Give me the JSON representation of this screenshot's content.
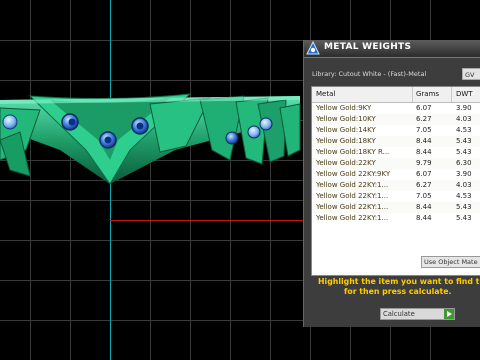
{
  "panel": {
    "title": "METAL WEIGHTS",
    "library_label": "Library: Cutout White - (Fast)-Metal",
    "library_button": "GV",
    "columns": [
      "Metal",
      "Grams",
      "DWT"
    ],
    "rows": [
      {
        "metal": "Yellow Gold:9KY",
        "grams": "6.07",
        "dwt": "3.90"
      },
      {
        "metal": "Yellow Gold:10KY",
        "grams": "6.27",
        "dwt": "4.03"
      },
      {
        "metal": "Yellow Gold:14KY",
        "grams": "7.05",
        "dwt": "4.53"
      },
      {
        "metal": "Yellow Gold:18KY",
        "grams": "8.44",
        "dwt": "5.43"
      },
      {
        "metal": "Yellow Gold:18KY R...",
        "grams": "8.44",
        "dwt": "5.43"
      },
      {
        "metal": "Yellow Gold:22KY",
        "grams": "9.79",
        "dwt": "6.30"
      },
      {
        "metal": "Yellow Gold 22KY:9KY",
        "grams": "6.07",
        "dwt": "3.90"
      },
      {
        "metal": "Yellow Gold 22KY:1...",
        "grams": "6.27",
        "dwt": "4.03"
      },
      {
        "metal": "Yellow Gold 22KY:1...",
        "grams": "7.05",
        "dwt": "4.53"
      },
      {
        "metal": "Yellow Gold 22KY:1...",
        "grams": "8.44",
        "dwt": "5.43"
      },
      {
        "metal": "Yellow Gold 22KY:1...",
        "grams": "8.44",
        "dwt": "5.43"
      }
    ],
    "scroll_left": "<",
    "use_object_label": "Use Object Mate",
    "message_line1": "Highlight the item you want to find the",
    "message_line2": "for then press calculate.",
    "calculate_label": "Calculate"
  },
  "colors": {
    "viewport_bg": "#000000",
    "grid": "#3a3a3a",
    "axis_y": "#0aa8b8",
    "axis_x": "#c01818",
    "ring": "#1faa6e",
    "gem": "#2b6fd6",
    "highlight": "#ffcc00"
  }
}
